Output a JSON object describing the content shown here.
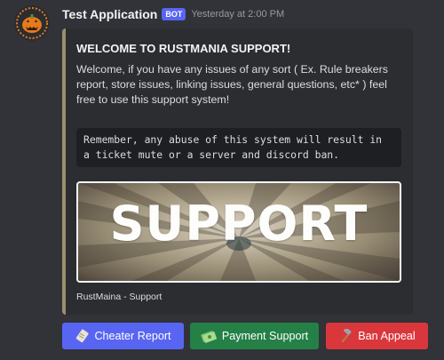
{
  "message": {
    "author": "Test Application",
    "bot_tag": "BOT",
    "timestamp": "Yesterday at 2:00 PM",
    "avatar_icon": "pumpkin-icon"
  },
  "embed": {
    "accent_color": "#9b8f6d",
    "title": "WELCOME TO RUSTMANIA SUPPORT!",
    "description": "Welcome, if you have any issues of any sort ( Ex. Rule breakers report, store issues, linking issues, general questions, etc* ) feel free to use this support system!",
    "code_line_1": "Remember, any abuse of this system will result in",
    "code_line_2": "a ticket mute or a server and discord ban.",
    "image_text": "SUPPORT",
    "footer": "RustMaina - Support"
  },
  "buttons": [
    {
      "label": "Cheater Report",
      "style": "primary",
      "color": "#5865f2",
      "icon": "scroll-icon"
    },
    {
      "label": "Payment Support",
      "style": "success",
      "color": "#248046",
      "icon": "money-icon"
    },
    {
      "label": "Ban Appeal",
      "style": "danger",
      "color": "#da373c",
      "icon": "hammer-icon"
    }
  ]
}
